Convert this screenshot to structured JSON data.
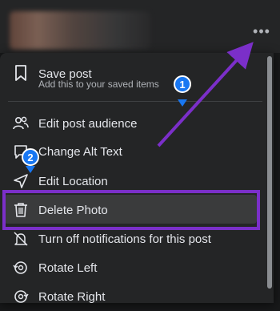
{
  "header": {
    "more_icon": "more-horizontal-icon",
    "more_label": "•••"
  },
  "menu": {
    "items": [
      {
        "label": "Save post",
        "sublabel": "Add this to your saved items",
        "icon": "bookmark-icon"
      },
      {
        "label": "Edit post audience",
        "icon": "people-icon"
      },
      {
        "label": "Change Alt Text",
        "icon": "speech-bubble-icon"
      },
      {
        "label": "Edit Location",
        "icon": "location-arrow-icon"
      },
      {
        "label": "Delete Photo",
        "icon": "trash-icon"
      },
      {
        "label": "Turn off notifications for this post",
        "icon": "bell-off-icon"
      },
      {
        "label": "Rotate Left",
        "icon": "rotate-left-icon"
      },
      {
        "label": "Rotate Right",
        "icon": "rotate-right-icon"
      }
    ]
  },
  "annotations": {
    "badge_1": "1",
    "badge_2": "2",
    "accent_color": "#7b2fc9",
    "badge_color": "#1877f2"
  }
}
